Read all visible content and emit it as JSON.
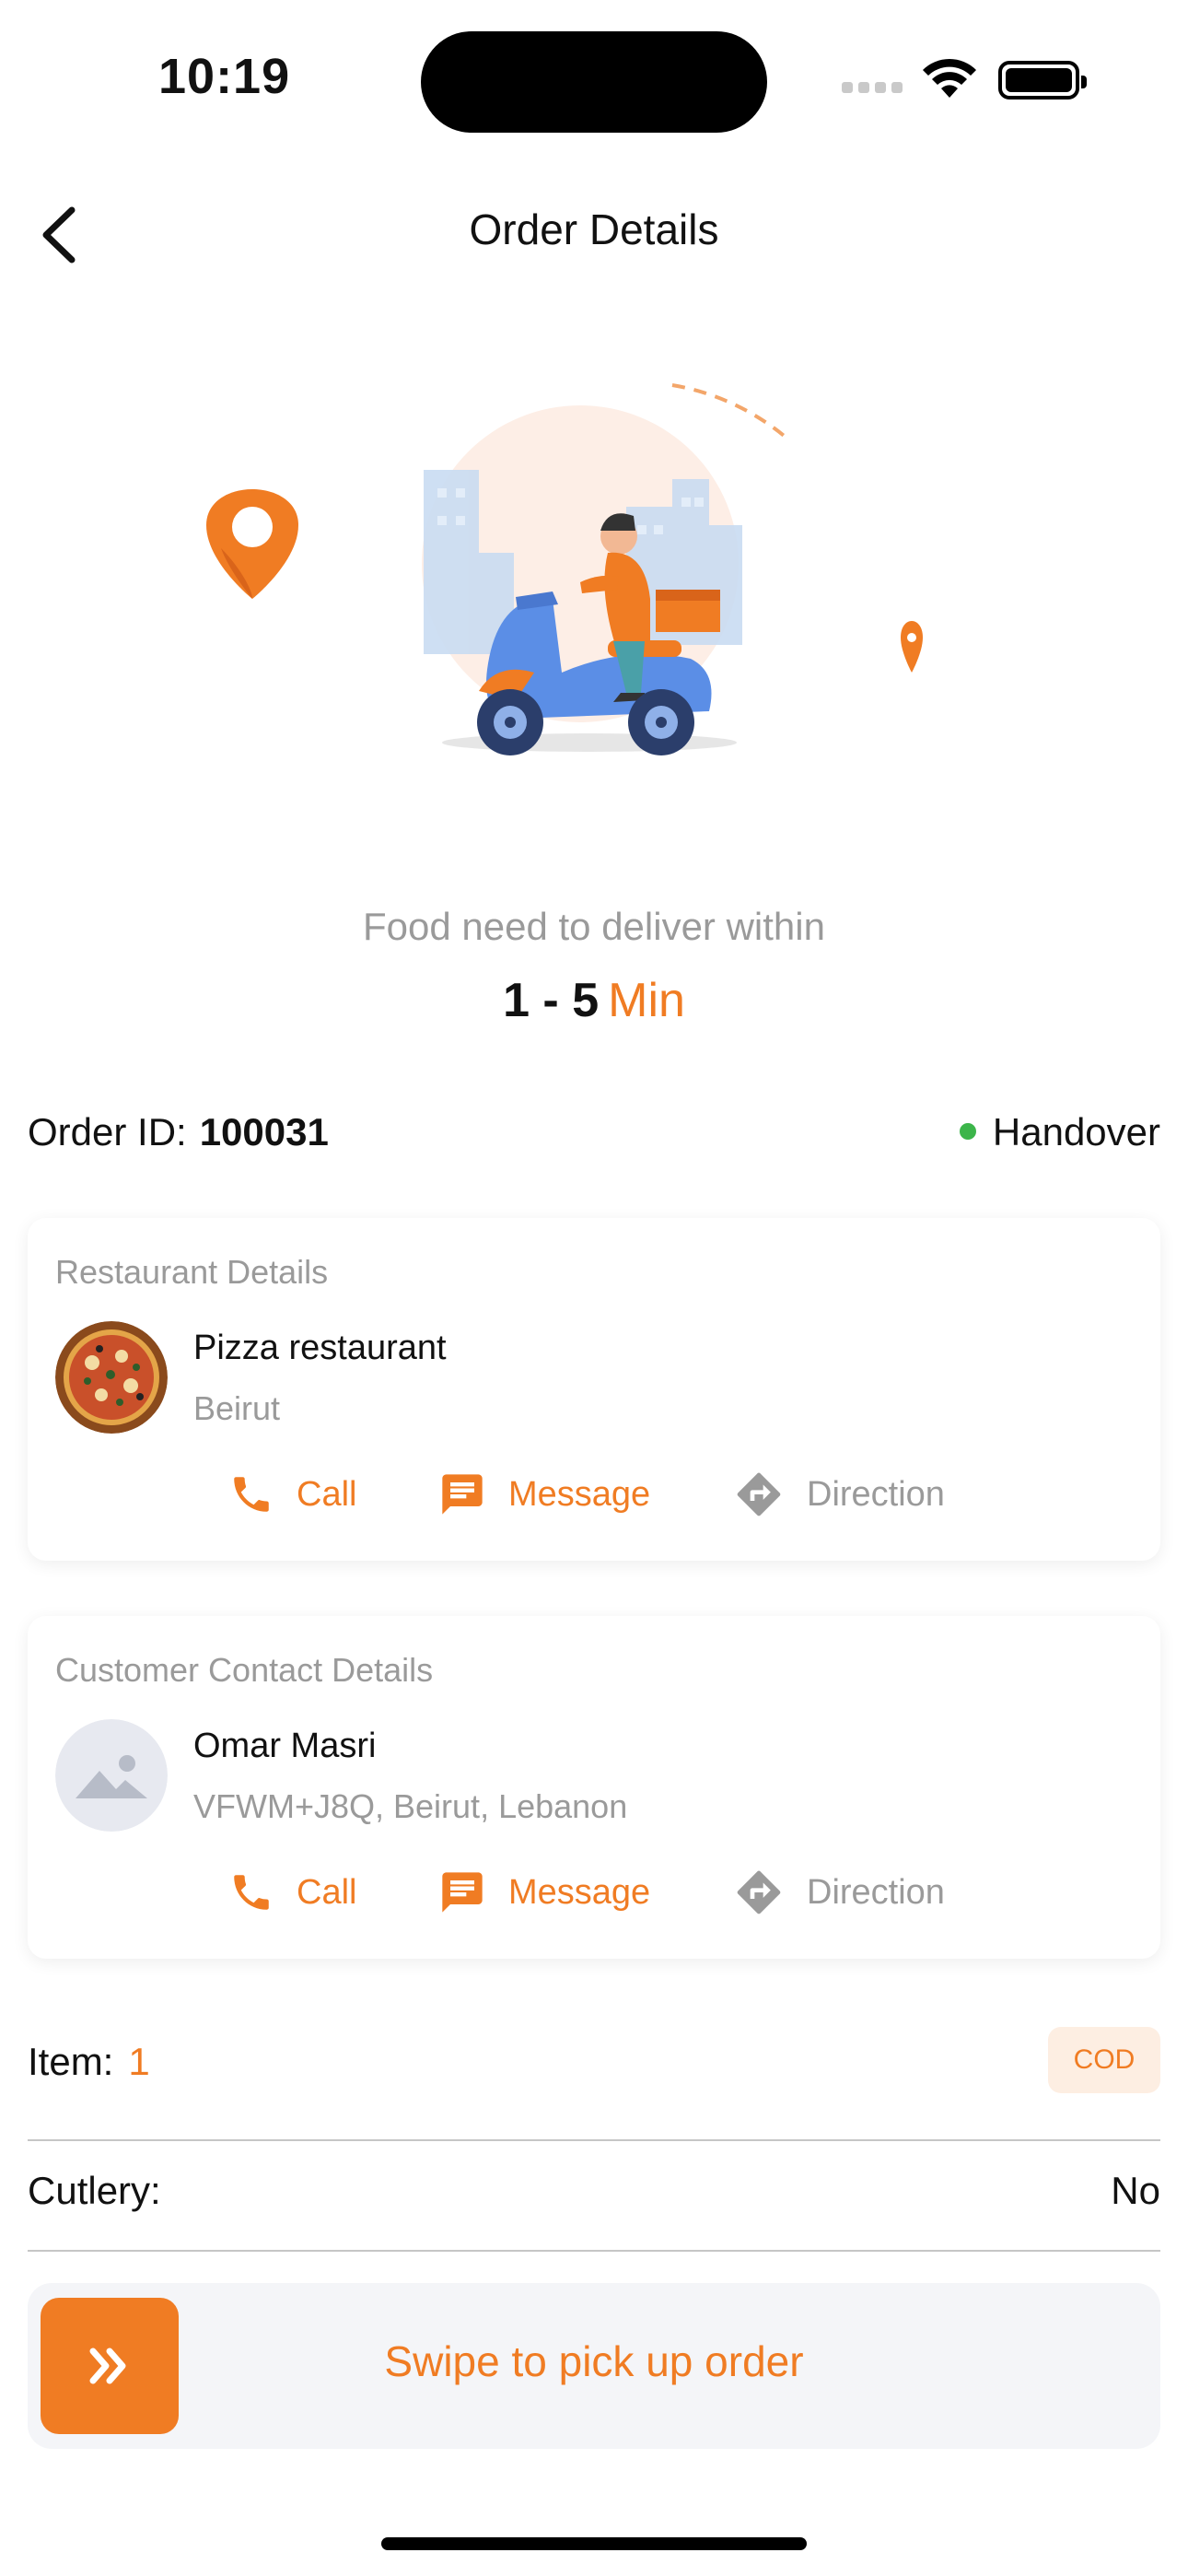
{
  "status_bar": {
    "time": "10:19"
  },
  "header": {
    "title": "Order Details"
  },
  "delivery": {
    "subtitle": "Food need to deliver within",
    "eta_range": "1 - 5",
    "eta_unit": "Min"
  },
  "order": {
    "id_label": "Order ID:",
    "id": "100031",
    "status": "Handover",
    "status_color": "#3cb54a"
  },
  "restaurant": {
    "section_title": "Restaurant Details",
    "name": "Pizza restaurant",
    "address": "Beirut",
    "actions": {
      "call": "Call",
      "message": "Message",
      "direction": "Direction"
    }
  },
  "customer": {
    "section_title": "Customer Contact Details",
    "name": "Omar Masri",
    "address": "VFWM+J8Q, Beirut, Lebanon",
    "actions": {
      "call": "Call",
      "message": "Message",
      "direction": "Direction"
    }
  },
  "items": {
    "label": "Item:",
    "count": "1",
    "payment_badge": "COD"
  },
  "cutlery": {
    "label": "Cutlery:",
    "value": "No"
  },
  "swipe": {
    "label": "Swipe to pick up order",
    "icon": "double-chevron-right-icon"
  },
  "colors": {
    "accent": "#f07c23",
    "muted": "#9a9a9a",
    "badge_bg": "#fdeee2",
    "swipe_bg": "#f4f5f8"
  }
}
